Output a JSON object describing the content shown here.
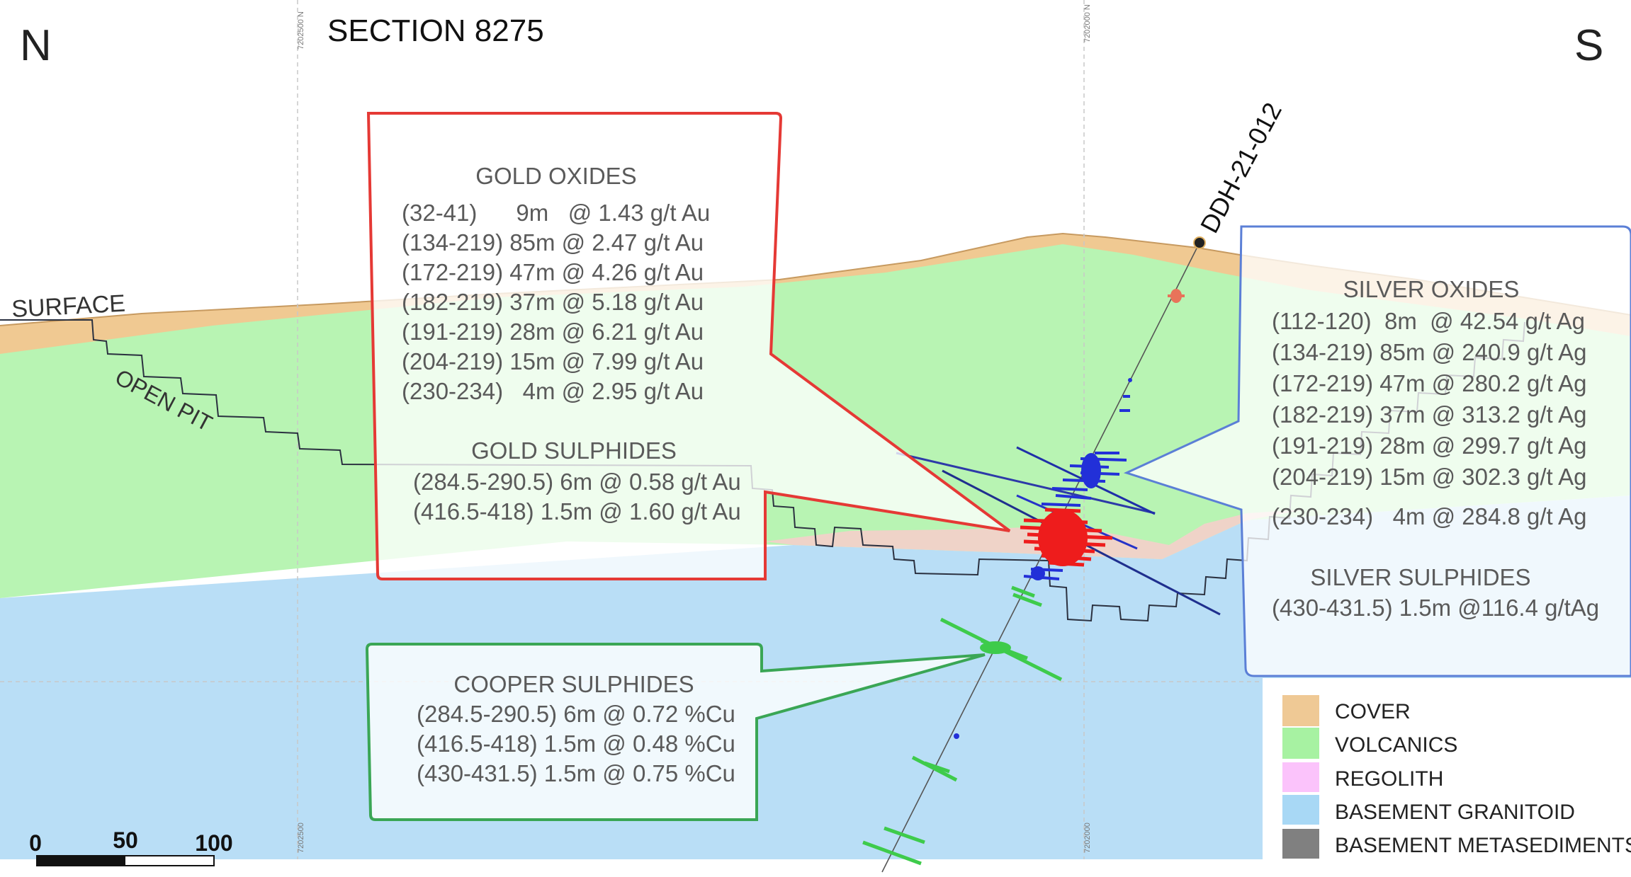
{
  "compass": {
    "north": "N",
    "south": "S"
  },
  "section_title": "SECTION 8275",
  "grid_labels": {
    "top_left": "7202500 N",
    "top_right": "7202000 N",
    "bottom_left": "7202500",
    "bottom_right": "7202000"
  },
  "labels": {
    "surface": "SURFACE",
    "open_pit": "OPEN PIT",
    "drillhole": "DDH-21-012"
  },
  "callouts": {
    "gold": {
      "color": "#e53935",
      "oxides_title": "GOLD OXIDES",
      "oxides": [
        "(32-41)      9m   @ 1.43 g/t Au",
        "(134-219) 85m @ 2.47 g/t Au",
        "(172-219) 47m @ 4.26 g/t Au",
        "(182-219) 37m @ 5.18 g/t Au",
        "(191-219) 28m @ 6.21 g/t Au",
        "(204-219) 15m @ 7.99 g/t Au",
        "(230-234)   4m @ 2.95 g/t Au"
      ],
      "sulphides_title": "GOLD SULPHIDES",
      "sulphides": [
        "(284.5-290.5) 6m @ 0.58 g/t Au",
        "(416.5-418) 1.5m @ 1.60 g/t Au"
      ]
    },
    "silver": {
      "color": "#5b7fd6",
      "oxides_title": "SILVER OXIDES",
      "oxides": [
        "(112-120)  8m  @ 42.54 g/t Ag",
        "(134-219) 85m @ 240.9 g/t Ag",
        "(172-219) 47m @ 280.2 g/t Ag",
        "(182-219) 37m @ 313.2 g/t Ag",
        "(191-219) 28m @ 299.7 g/t Ag",
        "(204-219) 15m @ 302.3 g/t Ag",
        "(230-234)   4m @ 284.8 g/t Ag"
      ],
      "sulphides_title": "SILVER SULPHIDES",
      "sulphides": [
        "(430-431.5) 1.5m @116.4 g/tAg"
      ]
    },
    "copper": {
      "color": "#3aa655",
      "title": "COOPER SULPHIDES",
      "lines": [
        "(284.5-290.5) 6m @ 0.72 %Cu",
        "(416.5-418) 1.5m @ 0.48 %Cu",
        "(430-431.5) 1.5m @ 0.75 %Cu"
      ]
    }
  },
  "legend": [
    {
      "label": "COVER",
      "color": "#efc995"
    },
    {
      "label": "VOLCANICS",
      "color": "#a7f2a2"
    },
    {
      "label": "REGOLITH",
      "color": "#fbc3fb"
    },
    {
      "label": "BASEMENT GRANITOID",
      "color": "#a8d8f5"
    },
    {
      "label": "BASEMENT METASEDIMENTS",
      "color": "#808080"
    }
  ],
  "scale_bar": {
    "ticks": [
      "0",
      "50",
      "100"
    ]
  }
}
